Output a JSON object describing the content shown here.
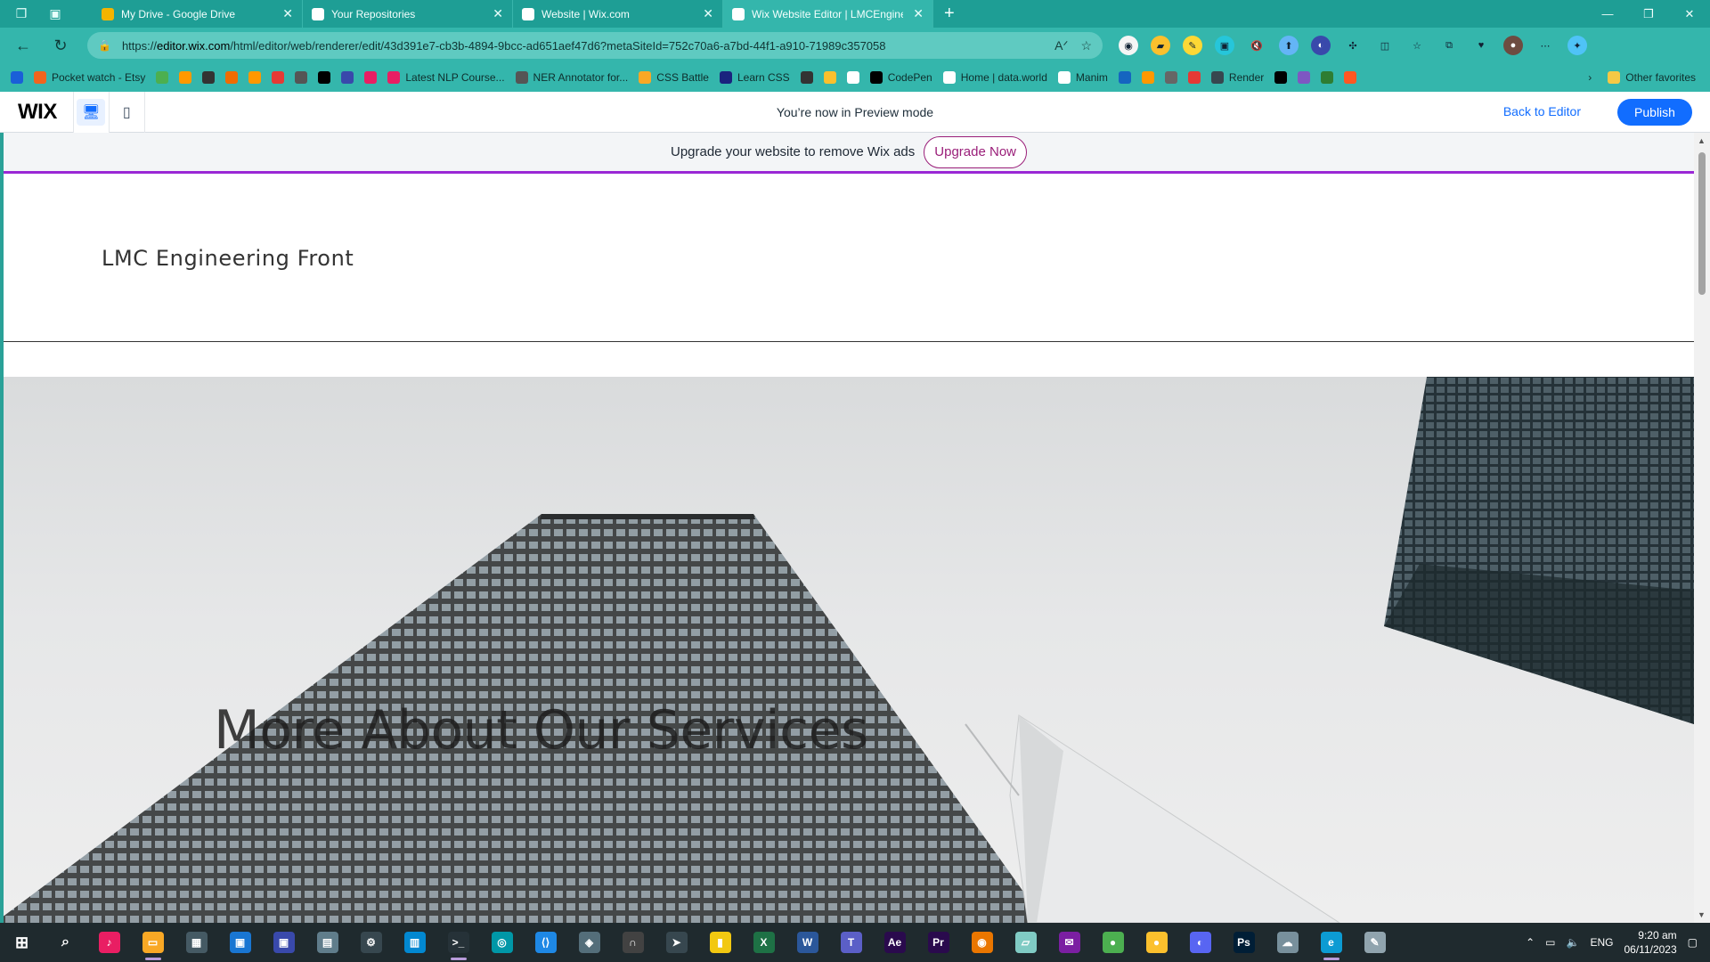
{
  "browser": {
    "tabs": [
      {
        "title": "My Drive - Google Drive",
        "favicon_color": "#f4b400",
        "active": false
      },
      {
        "title": "Your Repositories",
        "favicon_color": "#ffffff",
        "active": false
      },
      {
        "title": "Website | Wix.com",
        "favicon_color": "#ffffff",
        "active": false
      },
      {
        "title": "Wix Website Editor | LMCEngine",
        "favicon_color": "#ffffff",
        "active": true
      }
    ],
    "url_prefix": "https://",
    "url_host": "editor.wix.com",
    "url_path": "/html/editor/web/renderer/edit/43d391e7-cb3b-4894-9bcc-ad651aef47d6?metaSiteId=752c70a6-a7bd-44f1-a910-71989c357058",
    "bookmarks": [
      {
        "label": "",
        "color": "#1a5fd8"
      },
      {
        "label": "Pocket watch - Etsy",
        "color": "#f1641e"
      },
      {
        "label": "",
        "color": "#4caf50"
      },
      {
        "label": "",
        "color": "#ff9900"
      },
      {
        "label": "",
        "color": "#333333"
      },
      {
        "label": "",
        "color": "#ef6c00"
      },
      {
        "label": "",
        "color": "#ff9800"
      },
      {
        "label": "",
        "color": "#e53935"
      },
      {
        "label": "",
        "color": "#555555"
      },
      {
        "label": "",
        "color": "#000000"
      },
      {
        "label": "",
        "color": "#3949ab"
      },
      {
        "label": "",
        "color": "#e91e63"
      },
      {
        "label": "Latest NLP Course...",
        "color": "#e91e63"
      },
      {
        "label": "NER Annotator for...",
        "color": "#555555"
      },
      {
        "label": "CSS Battle",
        "color": "#f9a825"
      },
      {
        "label": "Learn CSS",
        "color": "#1a237e"
      },
      {
        "label": "",
        "color": "#333333"
      },
      {
        "label": "",
        "color": "#fbc02d"
      },
      {
        "label": "",
        "color": "#ffffff"
      },
      {
        "label": "CodePen",
        "color": "#000000"
      },
      {
        "label": "Home | data.world",
        "color": "#ffffff"
      },
      {
        "label": "Manim",
        "color": "#ffffff"
      },
      {
        "label": "",
        "color": "#1565c0"
      },
      {
        "label": "",
        "color": "#ff9800"
      },
      {
        "label": "",
        "color": "#666666"
      },
      {
        "label": "",
        "color": "#e53935"
      },
      {
        "label": "Render",
        "color": "#37474f"
      },
      {
        "label": "",
        "color": "#000000"
      },
      {
        "label": "",
        "color": "#7e57c2"
      },
      {
        "label": "",
        "color": "#2e7d32"
      },
      {
        "label": "",
        "color": "#ff5722"
      }
    ],
    "other_favorites": "Other favorites"
  },
  "wix_bar": {
    "logo": "WIX",
    "preview_text": "You’re now in Preview mode",
    "back_to_editor": "Back to Editor",
    "publish": "Publish"
  },
  "site": {
    "banner_text": "Upgrade your website to remove Wix ads",
    "upgrade_button": "Upgrade Now",
    "title": "LMC Engineering Front",
    "hero_heading": "More About Our Services"
  },
  "taskbar": {
    "apps": [
      {
        "icon": "itunes-icon",
        "color": "#e91e63",
        "glyph": "♪",
        "running": false
      },
      {
        "icon": "file-explorer-icon",
        "color": "#f9a825",
        "glyph": "▭",
        "running": true
      },
      {
        "icon": "calculator-icon",
        "color": "#455a64",
        "glyph": "▦",
        "running": false
      },
      {
        "icon": "app-icon",
        "color": "#1976d2",
        "glyph": "▣",
        "running": false
      },
      {
        "icon": "app-icon",
        "color": "#3949ab",
        "glyph": "▣",
        "running": false
      },
      {
        "icon": "app-icon",
        "color": "#607d8b",
        "glyph": "▤",
        "running": false
      },
      {
        "icon": "settings-icon",
        "color": "#37474f",
        "glyph": "⚙",
        "running": false
      },
      {
        "icon": "app-icon",
        "color": "#0288d1",
        "glyph": "▥",
        "running": false
      },
      {
        "icon": "terminal-icon",
        "color": "#263238",
        "glyph": ">_",
        "running": true
      },
      {
        "icon": "app-icon",
        "color": "#0097a7",
        "glyph": "◎",
        "running": false
      },
      {
        "icon": "vscode-icon",
        "color": "#1e88e5",
        "glyph": "⟨⟩",
        "running": false
      },
      {
        "icon": "app-icon",
        "color": "#546e7a",
        "glyph": "◈",
        "running": false
      },
      {
        "icon": "app-icon",
        "color": "#424242",
        "glyph": "∩",
        "running": false
      },
      {
        "icon": "app-icon",
        "color": "#37474f",
        "glyph": "➤",
        "running": false
      },
      {
        "icon": "power-bi-icon",
        "color": "#f2c811",
        "glyph": "▮",
        "running": false
      },
      {
        "icon": "excel-icon",
        "color": "#1e7145",
        "glyph": "X",
        "running": false
      },
      {
        "icon": "word-icon",
        "color": "#2b579a",
        "glyph": "W",
        "running": false
      },
      {
        "icon": "teams-icon",
        "color": "#5b5fc7",
        "glyph": "T",
        "running": false
      },
      {
        "icon": "after-effects-icon",
        "color": "#2a0a4d",
        "glyph": "Ae",
        "running": false
      },
      {
        "icon": "premiere-icon",
        "color": "#2a0a4d",
        "glyph": "Pr",
        "running": false
      },
      {
        "icon": "blender-icon",
        "color": "#ea7600",
        "glyph": "◉",
        "running": false
      },
      {
        "icon": "app-icon",
        "color": "#80cbc4",
        "glyph": "▱",
        "running": false
      },
      {
        "icon": "messenger-icon",
        "color": "#7b1fa2",
        "glyph": "✉",
        "running": false
      },
      {
        "icon": "chrome-icon",
        "color": "#4caf50",
        "glyph": "●",
        "running": false
      },
      {
        "icon": "chrome-icon",
        "color": "#fbc02d",
        "glyph": "●",
        "running": false
      },
      {
        "icon": "discord-icon",
        "color": "#5865f2",
        "glyph": "◐",
        "running": false
      },
      {
        "icon": "photoshop-icon",
        "color": "#001e36",
        "glyph": "Ps",
        "running": false
      },
      {
        "icon": "app-icon",
        "color": "#78909c",
        "glyph": "☁",
        "running": false
      },
      {
        "icon": "edge-icon",
        "color": "#0c9bd3",
        "glyph": "e",
        "running": true
      },
      {
        "icon": "app-icon",
        "color": "#90a4ae",
        "glyph": "✎",
        "running": false
      }
    ],
    "language": "ENG",
    "time": "9:20 am",
    "date": "06/11/2023"
  }
}
